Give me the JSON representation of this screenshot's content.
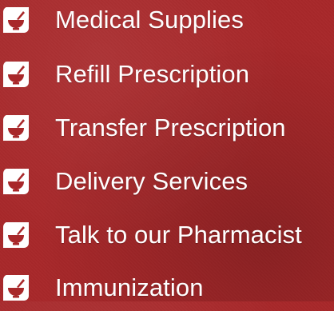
{
  "menu": {
    "items": [
      {
        "label": "Medical Supplies",
        "icon": "mortar-pestle-icon"
      },
      {
        "label": "Refill Prescription",
        "icon": "mortar-pestle-icon"
      },
      {
        "label": "Transfer Prescription",
        "icon": "mortar-pestle-icon"
      },
      {
        "label": "Delivery Services",
        "icon": "mortar-pestle-icon"
      },
      {
        "label": "Talk to our Pharmacist",
        "icon": "mortar-pestle-icon"
      },
      {
        "label": "Immunization",
        "icon": "mortar-pestle-icon"
      }
    ]
  },
  "colors": {
    "background": "#a8282a",
    "icon_badge": "#ffffff",
    "icon_glyph": "#a8282a",
    "text": "#ffffff"
  }
}
